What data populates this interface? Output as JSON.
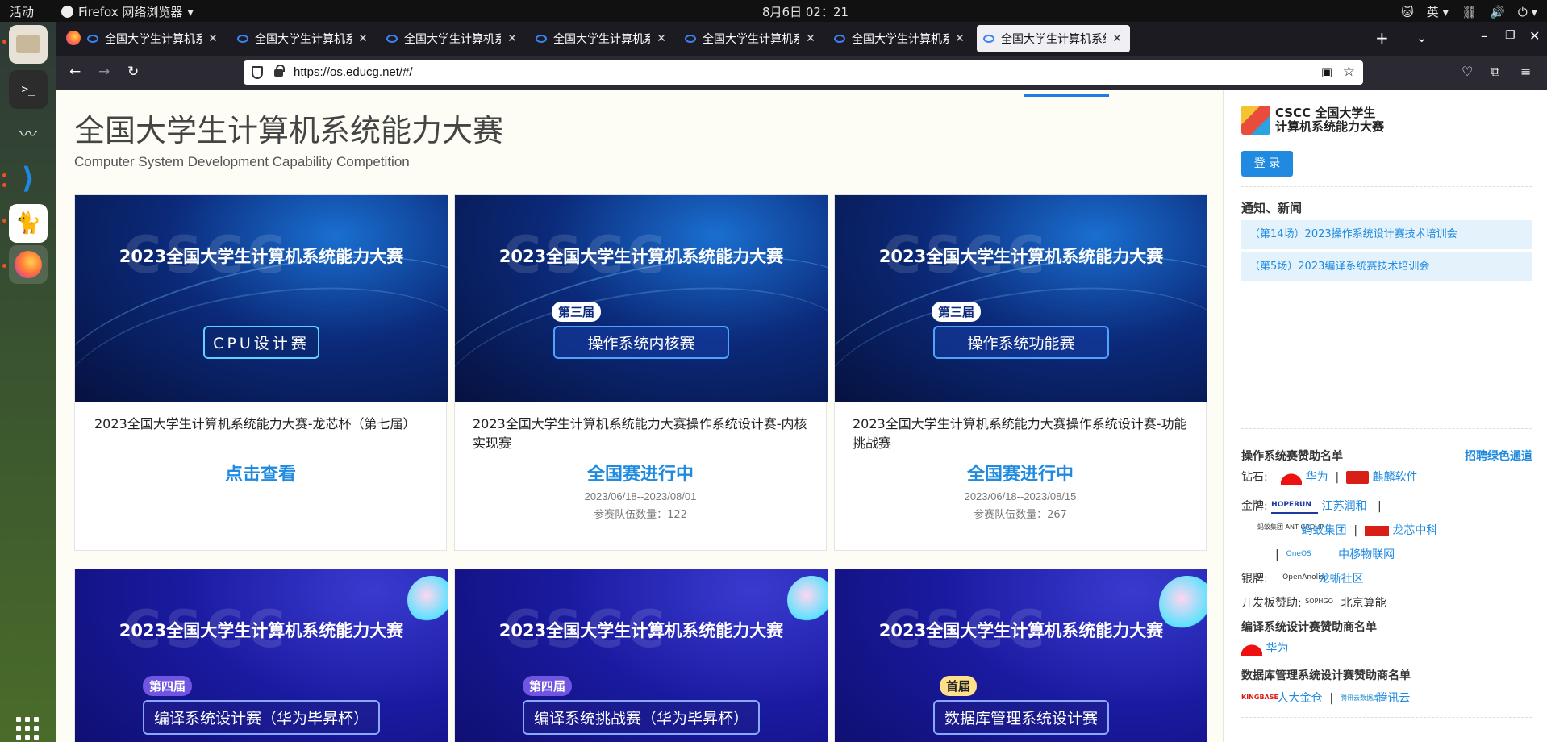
{
  "topbar": {
    "activities": "活动",
    "app_name": "Firefox 网络浏览器",
    "clock": "8月6日  02：21",
    "ime": "英"
  },
  "tabs": [
    {
      "title": "全国大学生计算机系统能力大赛"
    },
    {
      "title": "全国大学生计算机系统能力大赛"
    },
    {
      "title": "全国大学生计算机系统能力大赛"
    },
    {
      "title": "全国大学生计算机系统能力大赛"
    },
    {
      "title": "全国大学生计算机系统能力大赛"
    },
    {
      "title": "全国大学生计算机系统能力大赛"
    },
    {
      "title": "全国大学生计算机系统能力大赛",
      "active": true
    }
  ],
  "url": "https://os.educg.net/#/",
  "page": {
    "title": "全国大学生计算机系统能力大赛",
    "subtitle": "Computer System Development Capability Competition",
    "cards": [
      {
        "banner_title": "2023全国大学生计算机系统能力大赛",
        "banner_watermark": "CSCC",
        "banner_label": "CPU设计赛",
        "title": "2023全国大学生计算机系统能力大赛-龙芯杯（第七届）",
        "status": "点击查看"
      },
      {
        "banner_title": "2023全国大学生计算机系统能力大赛",
        "banner_watermark": "CSCC",
        "edition": "第三届",
        "banner_label": "操作系统内核赛",
        "title": "2023全国大学生计算机系统能力大赛操作系统设计赛-内核实现赛",
        "status": "全国赛进行中",
        "dates": "2023/06/18--2023/08/01",
        "teams": "参赛队伍数量：122"
      },
      {
        "banner_title": "2023全国大学生计算机系统能力大赛",
        "banner_watermark": "CSCC",
        "edition": "第三届",
        "banner_label": "操作系统功能赛",
        "title": "2023全国大学生计算机系统能力大赛操作系统设计赛-功能挑战赛",
        "status": "全国赛进行中",
        "dates": "2023/06/18--2023/08/15",
        "teams": "参赛队伍数量：267"
      },
      {
        "banner_title": "2023全国大学生计算机系统能力大赛",
        "banner_watermark": "CSCC",
        "edition": "第四届",
        "banner_label": "编译系统设计赛（华为毕昇杯）"
      },
      {
        "banner_title": "2023全国大学生计算机系统能力大赛",
        "banner_watermark": "CSCC",
        "edition": "第四届",
        "banner_label": "编译系统挑战赛（华为毕昇杯）"
      },
      {
        "banner_title": "2023全国大学生计算机系统能力大赛",
        "banner_watermark": "CSCC",
        "edition": "首届",
        "banner_label": "数据库管理系统设计赛"
      }
    ]
  },
  "sidebar": {
    "logo_line1": "CSCC 全国大学生",
    "logo_line2": "计算机系统能力大赛",
    "login": "登 录",
    "news_heading": "通知、新闻",
    "news": [
      "（第14场）2023操作系统设计赛技术培训会",
      "（第5场）2023编译系统赛技术培训会"
    ],
    "os_sponsors_heading": "操作系统赛赞助名单",
    "green_channel": "招聘绿色通道",
    "diamond_label": "钻石:",
    "diamond": [
      "华为",
      "麒麟软件"
    ],
    "gold_label": "金牌:",
    "gold": [
      "江苏润和",
      "蚂蚁集团",
      "龙芯中科",
      "中移物联网"
    ],
    "silver_label": "银牌:",
    "silver": [
      "龙蜥社区"
    ],
    "board_label": "开发板赞助:",
    "board": [
      "北京算能"
    ],
    "compiler_heading": "编译系统设计赛赞助商名单",
    "compiler": [
      "华为"
    ],
    "db_heading": "数据库管理系统设计赛赞助商名单",
    "db": [
      "人大金仓",
      "腾讯云"
    ],
    "logo_texts": {
      "hope": "HOPERUN",
      "ant": "蚂蚁集团 ANT GROUP",
      "cmcc": "OneOS",
      "anolis": "OpenAnolis",
      "sophgo": "SOPHGO",
      "kb": "KINGBASE",
      "tc": "腾讯云数据库"
    }
  }
}
